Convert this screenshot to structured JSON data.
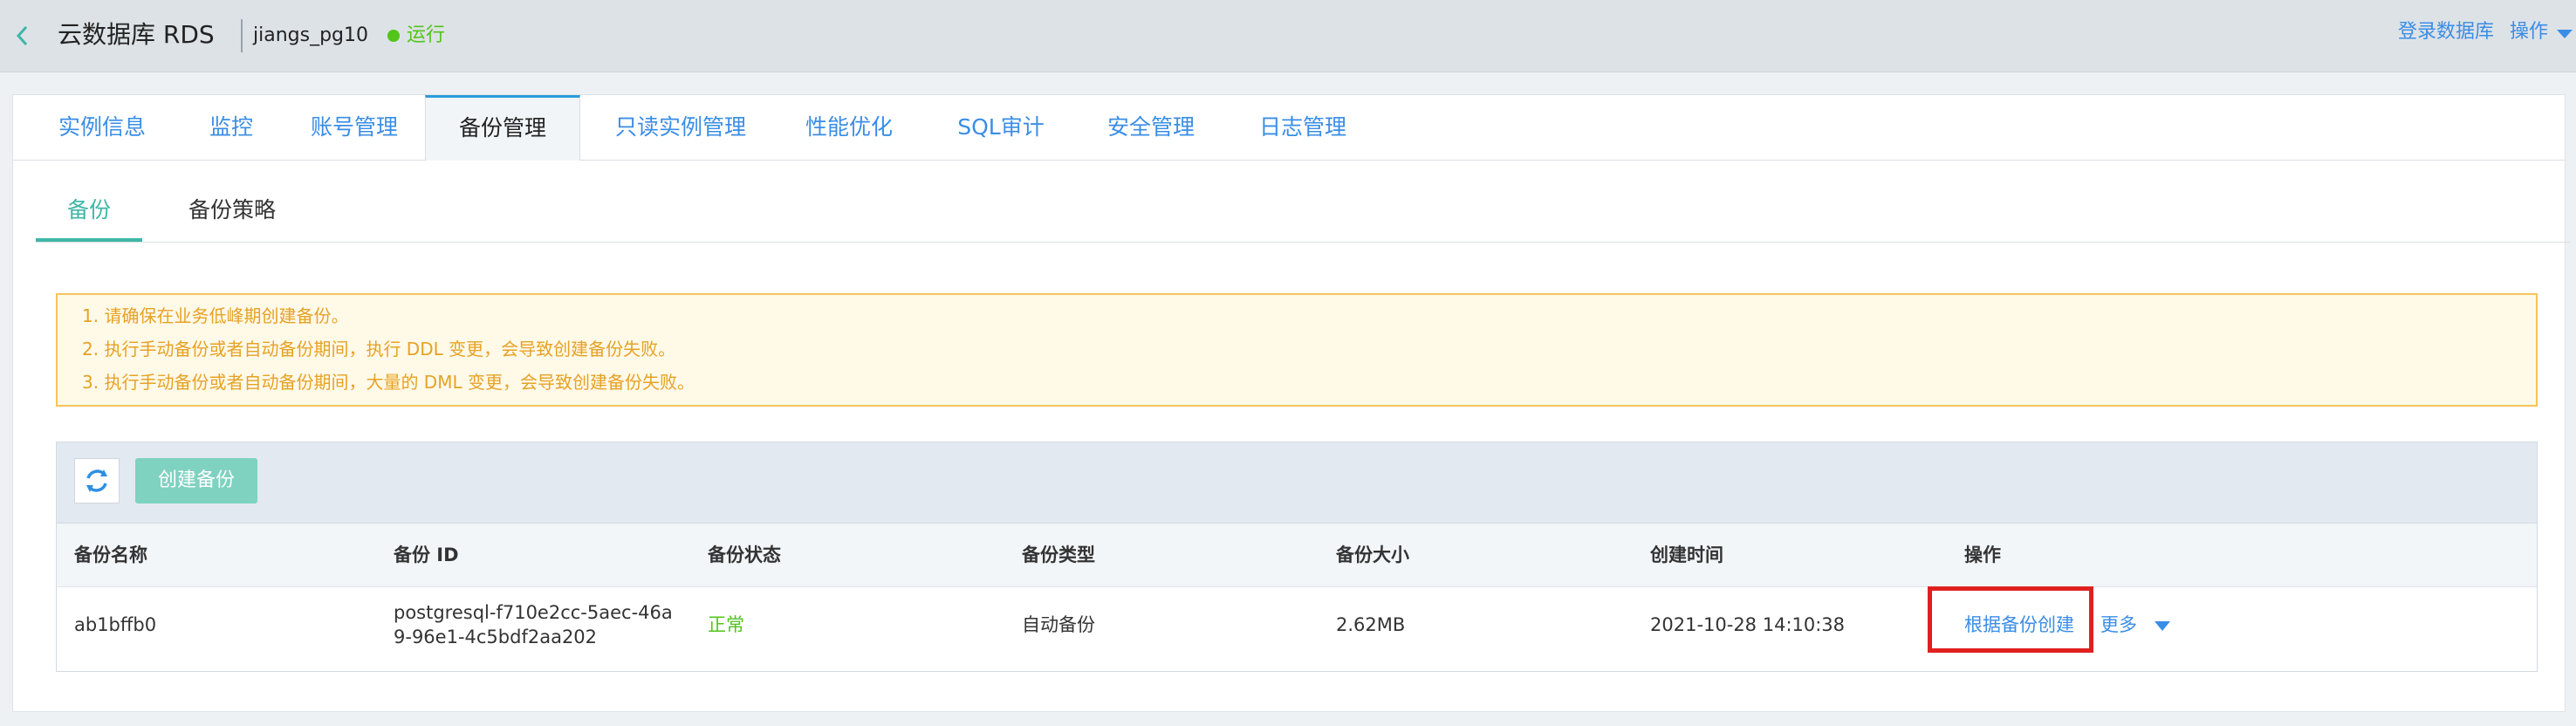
{
  "header": {
    "app_title": "云数据库 RDS",
    "instance_name": "jiangs_pg10",
    "status": "运行",
    "login_link": "登录数据库",
    "ops_link": "操作"
  },
  "tabs": [
    {
      "label": "实例信息"
    },
    {
      "label": "监控"
    },
    {
      "label": "账号管理"
    },
    {
      "label": "备份管理"
    },
    {
      "label": "只读实例管理"
    },
    {
      "label": "性能优化"
    },
    {
      "label": "SQL审计"
    },
    {
      "label": "安全管理"
    },
    {
      "label": "日志管理"
    }
  ],
  "subtabs": [
    {
      "label": "备份"
    },
    {
      "label": "备份策略"
    }
  ],
  "notice": [
    "1. 请确保在业务低峰期创建备份。",
    "2. 执行手动备份或者自动备份期间，执行 DDL 变更，会导致创建备份失败。",
    "3. 执行手动备份或者自动备份期间，大量的 DML 变更，会导致创建备份失败。"
  ],
  "toolbar": {
    "create_label": "创建备份"
  },
  "table": {
    "columns": [
      "备份名称",
      "备份 ID",
      "备份状态",
      "备份类型",
      "备份大小",
      "创建时间",
      "操作"
    ],
    "rows": [
      {
        "name": "ab1bffb0",
        "id_line1": "postgresql-f710e2cc-5aec-46a",
        "id_line2": "9-96e1-4c5bdf2aa202",
        "status": "正常",
        "type": "自动备份",
        "size": "2.62MB",
        "created": "2021-10-28 14:10:38",
        "action_create": "根据备份创建",
        "action_more": "更多"
      }
    ]
  },
  "colors": {
    "accent": "#3a8de6",
    "teal": "#3fb6a8",
    "success": "#52c41a",
    "warning": "#e6a225",
    "highlight": "#e02020"
  },
  "icons": {
    "back": "chevron-left-icon",
    "refresh": "refresh-icon",
    "more": "caret-down-icon"
  }
}
